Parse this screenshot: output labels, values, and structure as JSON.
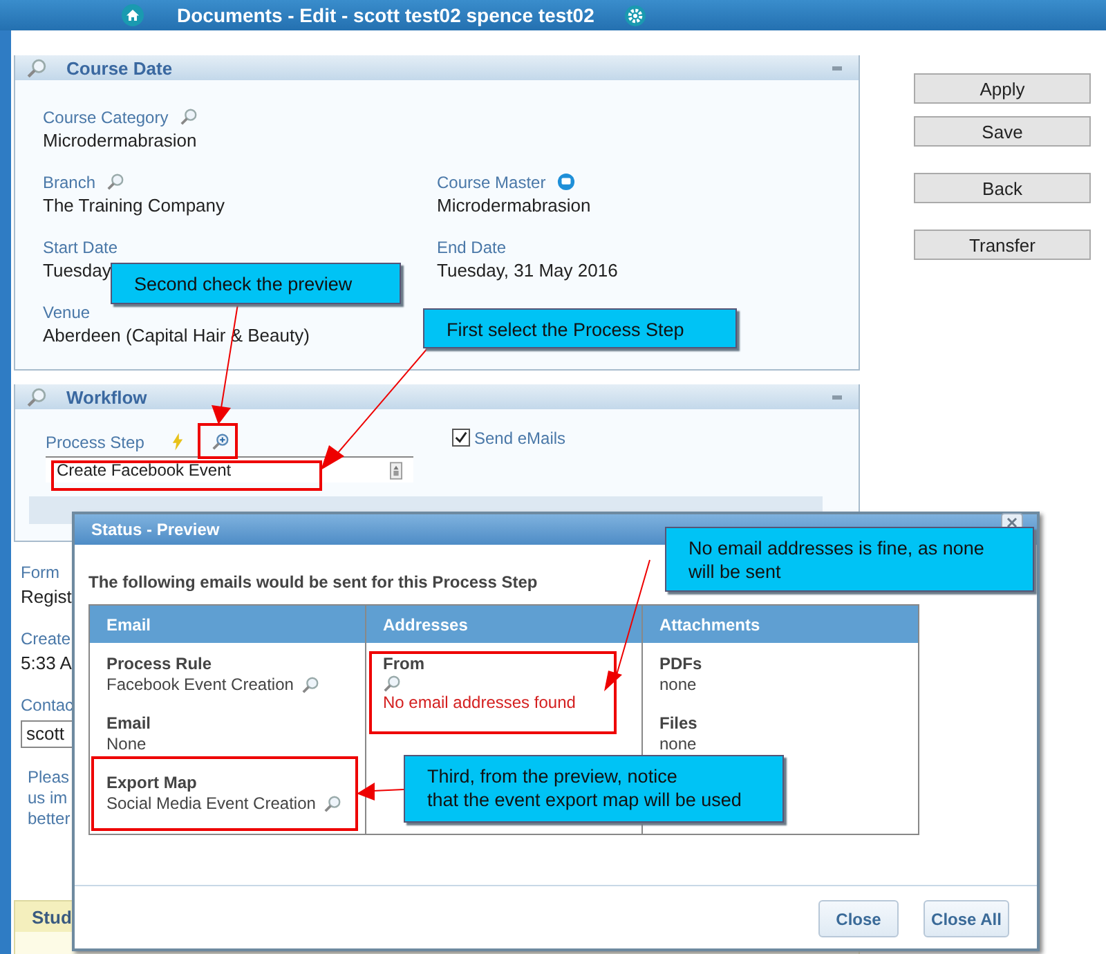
{
  "window": {
    "title": "Documents - Edit - scott test02 spence test02"
  },
  "course_date": {
    "title": "Course Date",
    "rows": [
      {
        "left": {
          "label": "Course Category",
          "value": "Microdermabrasion",
          "kind": "lookup"
        }
      },
      {
        "left": {
          "label": "Branch",
          "value": "The Training Company",
          "kind": "lookup"
        },
        "right": {
          "label": "Course Master",
          "value": "Microdermabrasion",
          "kind": "link"
        }
      },
      {
        "left": {
          "label": "Start Date",
          "value": "Tuesday",
          "kind": "plain"
        },
        "right": {
          "label": "End Date",
          "value": "Tuesday, 31 May 2016",
          "kind": "plain"
        }
      },
      {
        "left": {
          "label": "Venue",
          "value": "Aberdeen (Capital Hair & Beauty)",
          "kind": "plain"
        }
      }
    ]
  },
  "workflow": {
    "title": "Workflow",
    "process_step": {
      "label": "Process Step",
      "value": "Create Facebook Event"
    },
    "send_emails": {
      "label": "Send eMails",
      "checked": true
    }
  },
  "background_fields": [
    {
      "label": "Form",
      "value": "Regist",
      "kind": "text"
    },
    {
      "label": "Create",
      "value": "5:33 A",
      "kind": "text"
    },
    {
      "label": "Contac",
      "value": "scott",
      "kind": "input"
    }
  ],
  "note_lines": [
    "Pleas",
    "us im",
    "better"
  ],
  "student_panel": {
    "title": "Stud"
  },
  "buttons": [
    [
      "Apply",
      "Save"
    ],
    [
      "Back"
    ],
    [
      "Transfer"
    ]
  ],
  "dialog": {
    "title": "Status - Preview",
    "intro": "The following emails would be sent for this Process Step",
    "columns": [
      {
        "heading": "Email",
        "items": [
          {
            "heading": "Process Rule",
            "value": "Facebook Event Creation",
            "kind": "lookup",
            "error": false
          },
          {
            "heading": "Email",
            "value": "None",
            "kind": "plain",
            "error": false
          },
          {
            "heading": "Export Map",
            "value": "Social Media Event Creation",
            "kind": "lookup",
            "error": false
          }
        ]
      },
      {
        "heading": "Addresses",
        "items": [
          {
            "heading": "From",
            "value": "No email addresses found",
            "kind": "lookup_stacked",
            "error": true
          }
        ]
      },
      {
        "heading": "Attachments",
        "items": [
          {
            "heading": "PDFs",
            "value": "none",
            "kind": "plain",
            "error": false
          },
          {
            "heading": "Files",
            "value": "none",
            "kind": "plain",
            "error": false
          }
        ]
      }
    ],
    "buttons": [
      "Close",
      "Close All"
    ]
  },
  "callouts": [
    {
      "text": "Second check the preview"
    },
    {
      "text": "First select the Process Step"
    },
    {
      "text": "No email addresses is fine, as none\nwill be sent"
    },
    {
      "text": "Third, from the preview, notice\nthat the event export map will be used"
    }
  ]
}
